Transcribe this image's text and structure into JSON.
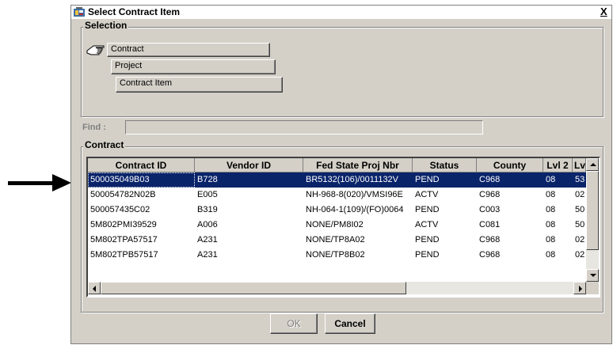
{
  "window": {
    "title": "Select Contract Item",
    "close_glyph": "X"
  },
  "selection": {
    "group_label": "Selection",
    "tree": [
      {
        "label": "Contract",
        "icon": "pointing-hand-icon"
      },
      {
        "label": "Project"
      },
      {
        "label": "Contract Item"
      }
    ]
  },
  "find": {
    "label": "Find :",
    "value": ""
  },
  "contract": {
    "group_label": "Contract",
    "columns": [
      "Contract ID",
      "Vendor ID",
      "Fed State Proj Nbr",
      "Status",
      "County",
      "Lvl 2",
      "Lv"
    ],
    "rows": [
      {
        "contract_id": "500035049B03",
        "vendor_id": "B728",
        "fed_state_proj_nbr": "BR5132(106)/0011132V",
        "status": "PEND",
        "county": "C968",
        "lvl2": "08",
        "lvl3": "53"
      },
      {
        "contract_id": "500054782N02B",
        "vendor_id": "E005",
        "fed_state_proj_nbr": "NH-968-8(020)/VMSI96E",
        "status": "ACTV",
        "county": "C968",
        "lvl2": "08",
        "lvl3": "02"
      },
      {
        "contract_id": "500057435C02",
        "vendor_id": "B319",
        "fed_state_proj_nbr": "NH-064-1(109)/(FO)0064",
        "status": "PEND",
        "county": "C003",
        "lvl2": "08",
        "lvl3": "50"
      },
      {
        "contract_id": "5M802PMI39529",
        "vendor_id": "A006",
        "fed_state_proj_nbr": "NONE/PM8I02",
        "status": "ACTV",
        "county": "C081",
        "lvl2": "08",
        "lvl3": "50"
      },
      {
        "contract_id": "5M802TPA57517",
        "vendor_id": "A231",
        "fed_state_proj_nbr": "NONE/TP8A02",
        "status": "PEND",
        "county": "C968",
        "lvl2": "08",
        "lvl3": "02"
      },
      {
        "contract_id": "5M802TPB57517",
        "vendor_id": "A231",
        "fed_state_proj_nbr": "NONE/TP8B02",
        "status": "PEND",
        "county": "C968",
        "lvl2": "08",
        "lvl3": "02"
      }
    ],
    "selected_row": 0
  },
  "buttons": {
    "ok": "OK",
    "cancel": "Cancel"
  },
  "colors": {
    "dialog_bg": "#d4d0c8",
    "selection_bg": "#0a246a"
  }
}
